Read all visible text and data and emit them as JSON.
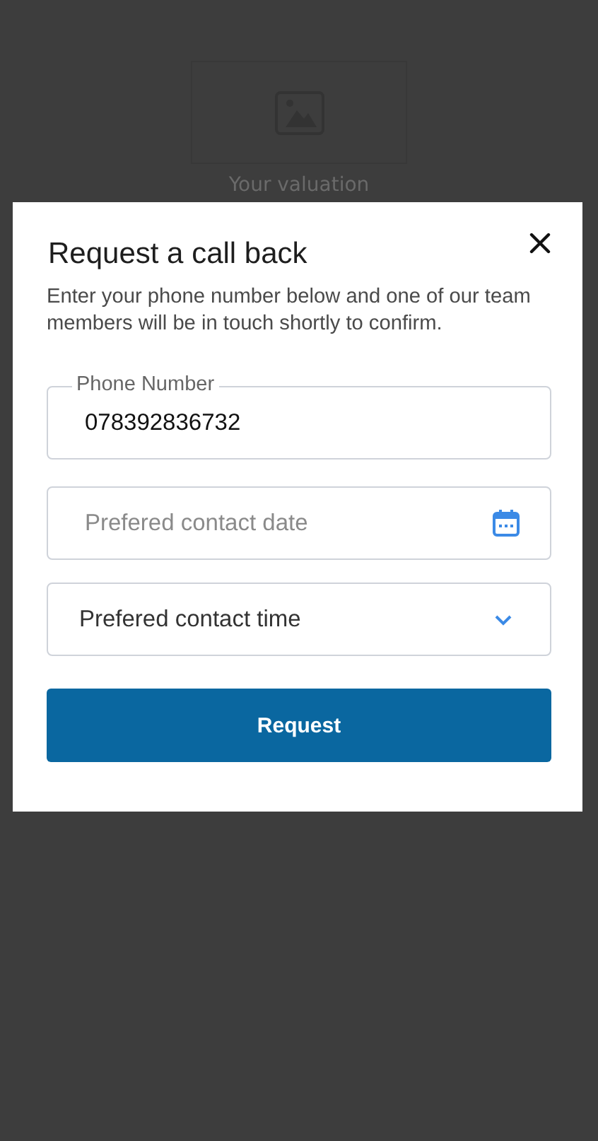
{
  "background": {
    "heading": "Your valuation"
  },
  "dialog": {
    "title": "Request a call back",
    "description": "Enter your phone number below and one of our team members will be in touch shortly to confirm.",
    "fields": [
      {
        "kind": "text",
        "label": "Phone Number",
        "value": "078392836732"
      },
      {
        "kind": "date",
        "placeholder": "Prefered contact date"
      },
      {
        "kind": "select",
        "value": "Prefered contact time"
      }
    ],
    "submit": "Request"
  }
}
